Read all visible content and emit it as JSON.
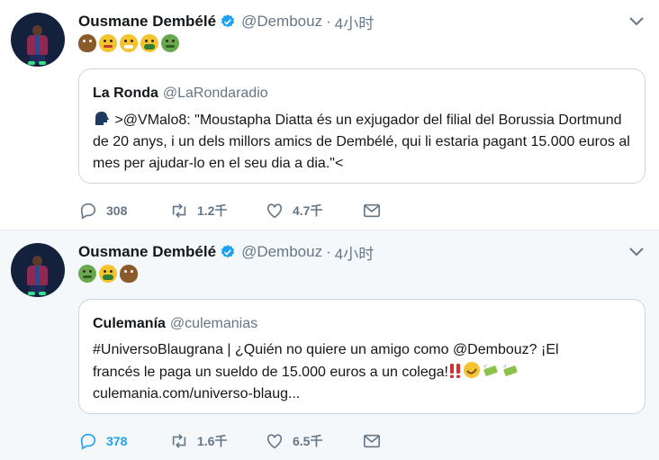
{
  "tweets": [
    {
      "author_name": "Ousmane Dembélé",
      "handle": "@Dembouz",
      "separator": "·",
      "time": "4小时",
      "emojis": [
        "poop-emoji",
        "face-with-steam-emoji",
        "mask-face-emoji",
        "vomit-face-emoji",
        "nauseated-face-emoji"
      ],
      "quote": {
        "name": "La Ronda",
        "handle": "@LaRondaradio",
        "icon": "speaking-head-emoji",
        "text": " >@VMalo8: \"Moustapha Diatta és un exjugador del filial del Borussia Dortmund de 20 anys, i un dels millors amics de Dembélé, qui li estaria pagant 15.000 euros al mes per ajudar-lo en el seu dia a dia.\"<"
      },
      "actions": {
        "replies": "308",
        "retweets": "1.2千",
        "likes": "4.7千"
      }
    },
    {
      "author_name": "Ousmane Dembélé",
      "handle": "@Dembouz",
      "separator": "·",
      "time": "4小时",
      "emojis": [
        "nauseated-face-emoji",
        "vomit-face-emoji",
        "poop-emoji"
      ],
      "quote": {
        "name": "Culemanía",
        "handle": "@culemanias",
        "text_line1": "#UniversoBlaugrana | ¿Quién no quiere un amigo como @Dembouz? ¡El",
        "text_line2": "francés le paga un sueldo de 15.000 euros a un colega!",
        "text_line2_emojis": [
          "double-exclamation-emoji",
          "rofl-emoji",
          "money-wings-emoji",
          "money-wings-emoji"
        ],
        "text_line3": "culemania.com/universo-blaug..."
      },
      "actions": {
        "replies": "378",
        "retweets": "1.6千",
        "likes": "6.5千"
      }
    }
  ],
  "colors": {
    "verified": "#1da1f2",
    "muted": "#657786",
    "border": "#ccd6dd",
    "highlight_bg": "#f5f8fa",
    "active_blue": "#1da1f2"
  }
}
